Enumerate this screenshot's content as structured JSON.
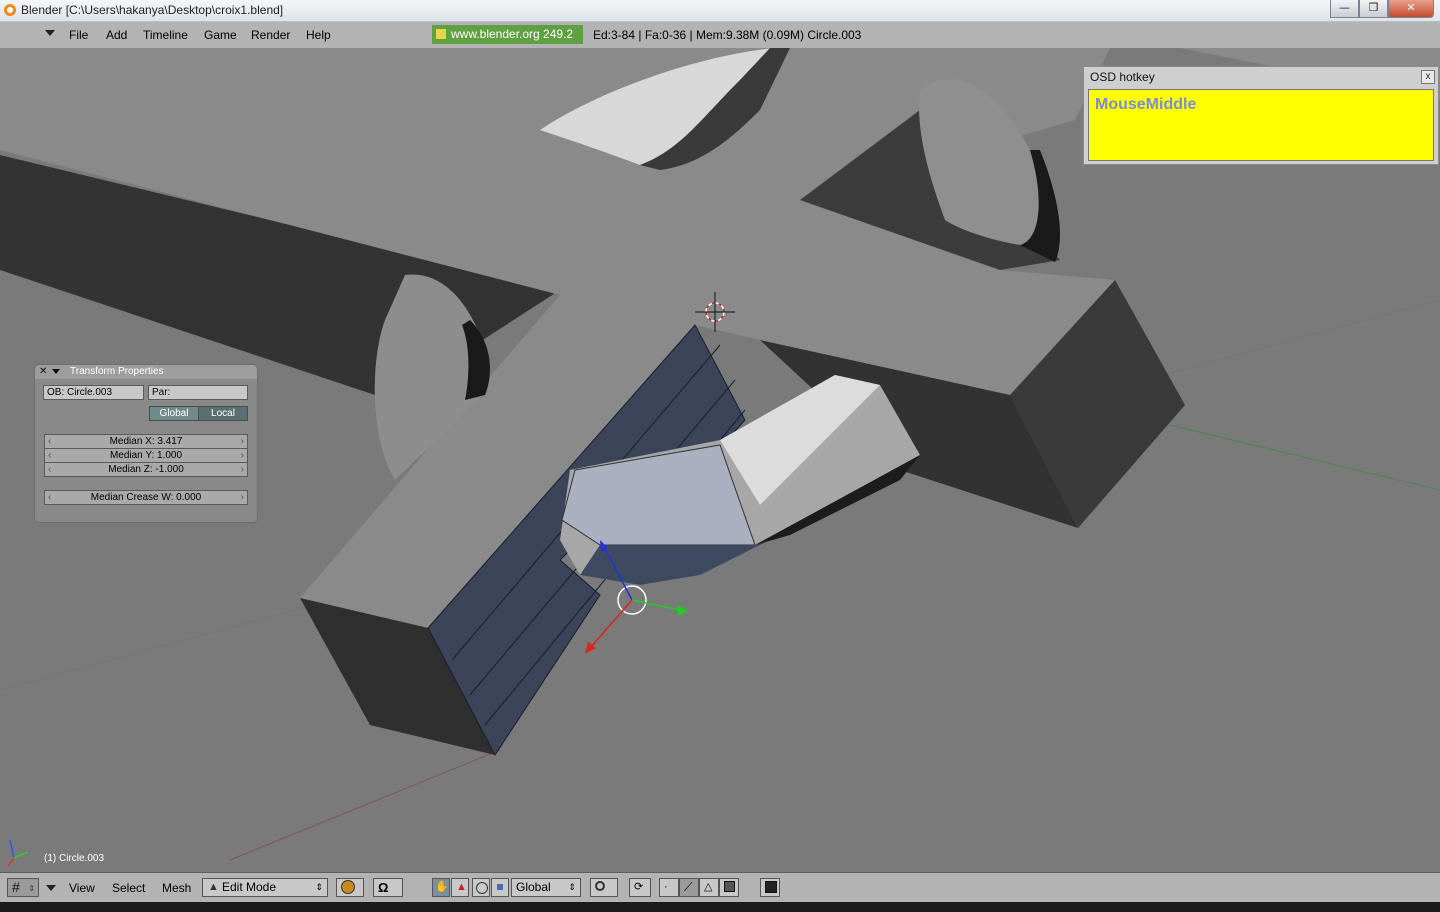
{
  "window": {
    "title": "Blender [C:\\Users\\hakanya\\Desktop\\croix1.blend]",
    "minimize": "—",
    "maximize": "❐",
    "close": "✕"
  },
  "menubar": {
    "items": [
      "File",
      "Add",
      "Timeline",
      "Game",
      "Render",
      "Help"
    ],
    "blender_link": "www.blender.org 249.2",
    "stats": "Ed:3-84 | Fa:0-36 | Mem:9.38M (0.09M) Circle.003"
  },
  "transform_panel": {
    "title": "Transform Properties",
    "ob_field": "OB: Circle.003",
    "par_field": "Par:",
    "global_label": "Global",
    "local_label": "Local",
    "median_x": "Median X: 3.417",
    "median_y": "Median Y: 1.000",
    "median_z": "Median Z: -1.000",
    "median_crease": "Median Crease W: 0.000"
  },
  "osd": {
    "title": "OSD hotkey",
    "close": "x",
    "text": "MouseMiddle"
  },
  "status": {
    "object_label": "(1) Circle.003"
  },
  "toolbar": {
    "view": "View",
    "select": "Select",
    "mesh": "Mesh",
    "mode": "Edit Mode",
    "orientation": "Global"
  },
  "colors": {
    "viewport_bg": "#7a7a7a",
    "osd_bg": "#ffff00",
    "osd_text": "#7d8cd6",
    "link_bg": "#5fa042",
    "selected_faces": "#3b4458"
  }
}
